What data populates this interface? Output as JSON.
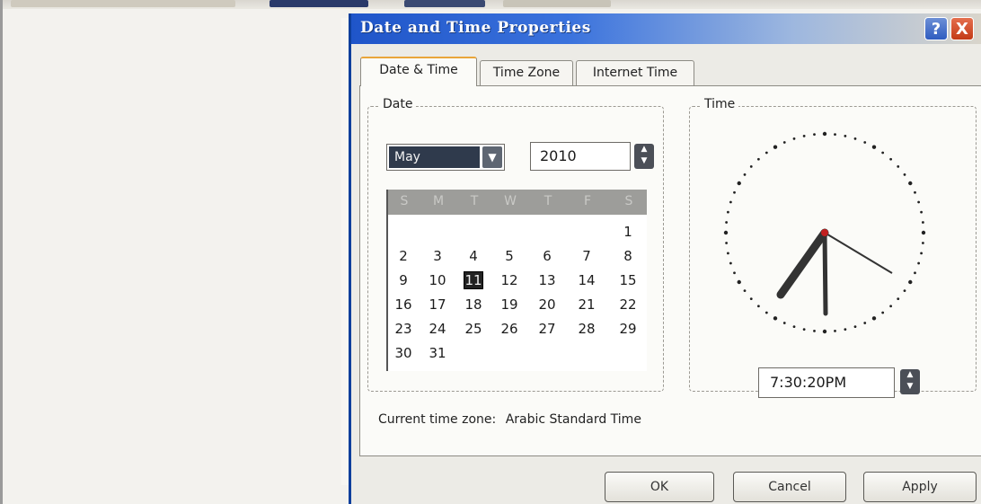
{
  "dialog": {
    "title": "Date and Time Properties",
    "help_glyph": "?",
    "close_glyph": "X"
  },
  "tabs": [
    {
      "label": "Date & Time",
      "active": true
    },
    {
      "label": "Time Zone",
      "active": false
    },
    {
      "label": "Internet Time",
      "active": false
    }
  ],
  "date_group": {
    "label": "Date",
    "month": "May",
    "year": "2010",
    "calendar": {
      "weekday_headers": [
        "S",
        "M",
        "T",
        "W",
        "T",
        "F",
        "S"
      ],
      "weeks": [
        [
          "",
          "",
          "",
          "",
          "",
          "",
          "1"
        ],
        [
          "2",
          "3",
          "4",
          "5",
          "6",
          "7",
          "8"
        ],
        [
          "9",
          "10",
          "11",
          "12",
          "13",
          "14",
          "15"
        ],
        [
          "16",
          "17",
          "18",
          "19",
          "20",
          "21",
          "22"
        ],
        [
          "23",
          "24",
          "25",
          "26",
          "27",
          "28",
          "29"
        ],
        [
          "30",
          "31",
          "",
          "",
          "",
          "",
          ""
        ]
      ],
      "selected_day": "11"
    }
  },
  "time_group": {
    "label": "Time",
    "time": "7:30:20PM"
  },
  "timezone": {
    "label": "Current time zone:",
    "value": "Arabic Standard Time"
  },
  "buttons": {
    "ok": "OK",
    "cancel": "Cancel",
    "apply": "Apply"
  },
  "icons": {
    "spin_up": "▲",
    "spin_down": "▼",
    "dropdown": "▼"
  },
  "colors": {
    "title_bar": "#1f55c9",
    "active_tab_accent": "#e9a53a",
    "clock_second_hand": "#c22020"
  }
}
